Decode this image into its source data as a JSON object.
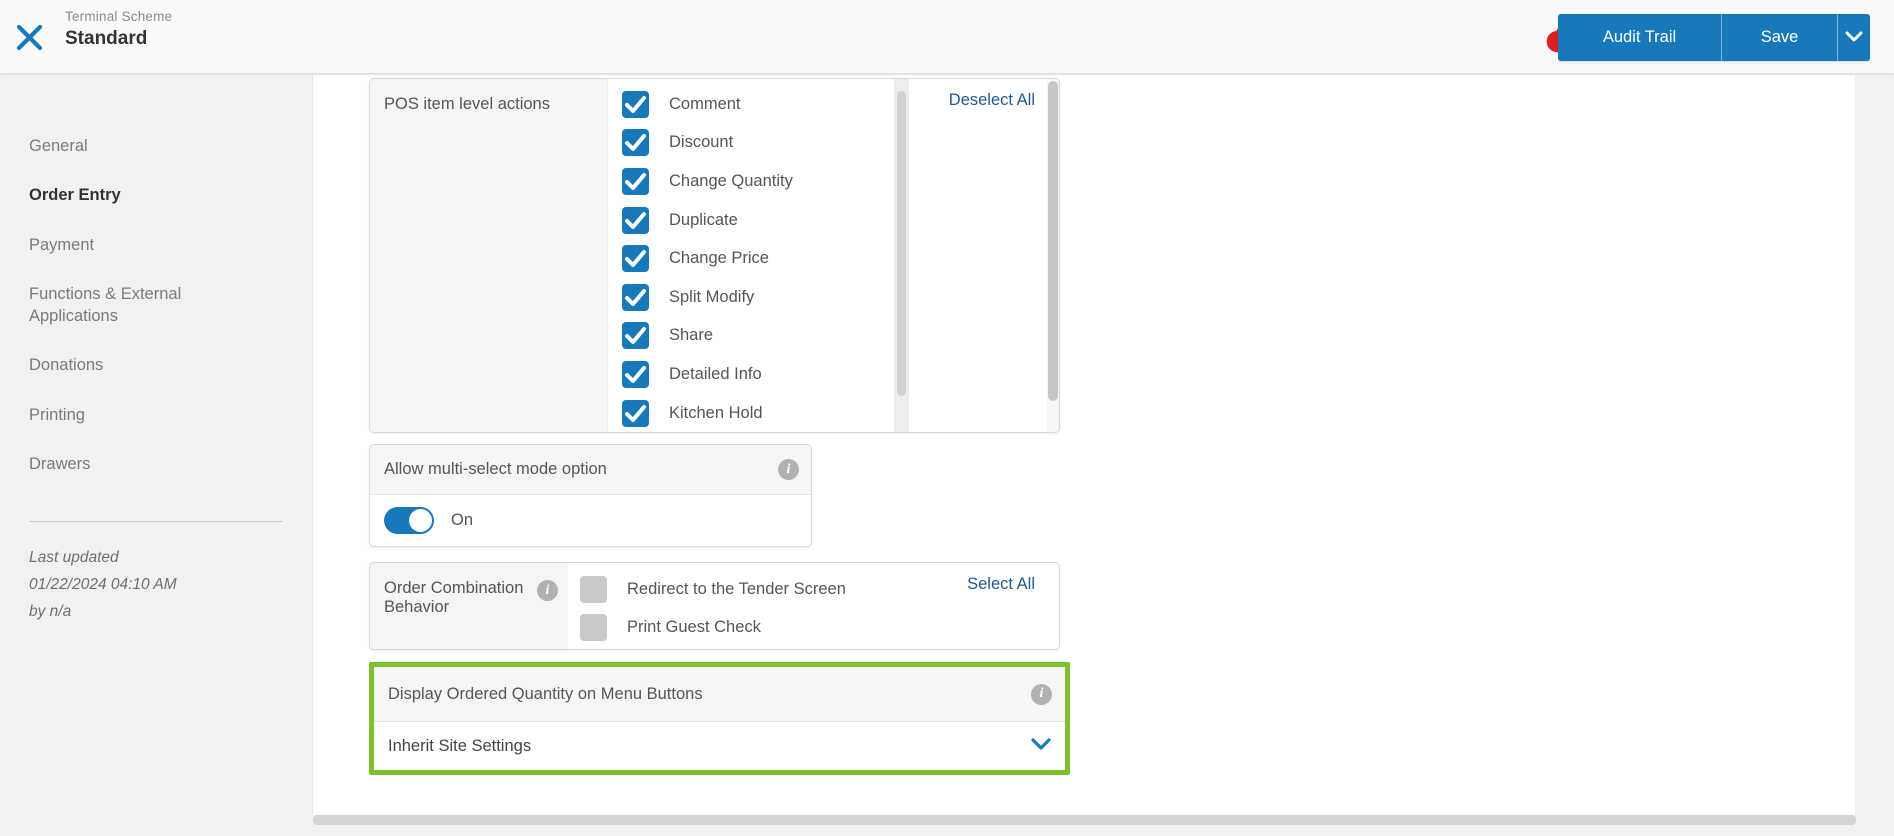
{
  "header": {
    "entity_type": "Terminal Scheme",
    "entity_name": "Standard",
    "audit_trail_label": "Audit Trail",
    "save_label": "Save"
  },
  "sidebar": {
    "items": [
      {
        "label": "General"
      },
      {
        "label": "Order Entry"
      },
      {
        "label": "Payment"
      },
      {
        "label": "Functions & External Applications"
      },
      {
        "label": "Donations"
      },
      {
        "label": "Printing"
      },
      {
        "label": "Drawers"
      }
    ],
    "active_item": "Order Entry",
    "last_updated_label": "Last updated",
    "last_updated_date": "01/22/2024 04:10 AM",
    "last_updated_by": "by n/a"
  },
  "main": {
    "pos_item_actions": {
      "label": "POS item level actions",
      "deselect_all_label": "Deselect All",
      "options": [
        "Comment",
        "Discount",
        "Change Quantity",
        "Duplicate",
        "Change Price",
        "Split Modify",
        "Share",
        "Detailed Info",
        "Kitchen Hold"
      ],
      "all_checked": true
    },
    "multi_select": {
      "label": "Allow multi-select mode option",
      "state_label": "On"
    },
    "order_combination": {
      "label": "Order Combination Behavior",
      "select_all_label": "Select All",
      "options": [
        "Redirect to the Tender Screen",
        "Print Guest Check"
      ],
      "all_unchecked": true
    },
    "display_ordered_qty": {
      "label": "Display Ordered Quantity on Menu Buttons",
      "value": "Inherit Site Settings"
    }
  },
  "icons": {
    "close": "x",
    "cloud_alert_glyph": "!",
    "info_glyph": "i",
    "chevron_down": "v"
  },
  "colors": {
    "primary_blue": "#1779ba",
    "link_blue": "#1e5a8d",
    "alert_red": "#dd1f26",
    "highlight_green": "#7cc02e",
    "panel_header_gray": "#f5f5f5"
  }
}
